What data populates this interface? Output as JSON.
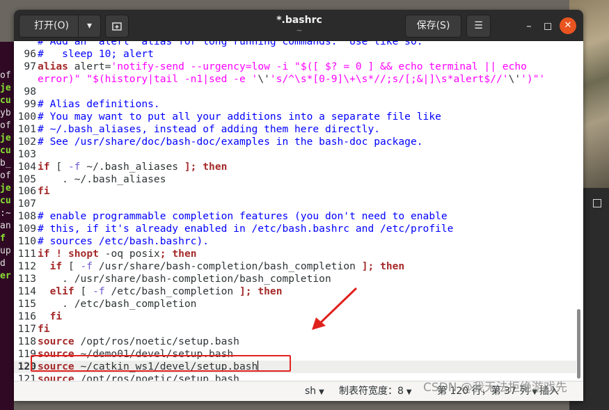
{
  "window": {
    "title": "*.bashrc",
    "subtitle": "~",
    "open_label": "打开(O)",
    "save_label": "保存(S)",
    "new_tab_icon": "new-tab-icon",
    "menu_icon": "hamburger-icon",
    "minimize_icon": "minimize-icon",
    "maximize_icon": "maximize-icon",
    "close_icon": "close-icon"
  },
  "editor": {
    "current_line": 120,
    "partial_top_text": "# Add an \"alert\" alias for long running commands.  Use like so:",
    "lines": [
      {
        "n": "96",
        "segments": [
          {
            "t": "#   sleep 10; alert",
            "c": "comment"
          }
        ]
      },
      {
        "n": "97",
        "segments": [
          {
            "t": "alias",
            "c": "kw"
          },
          {
            "t": " alert=",
            "c": "plain"
          },
          {
            "t": "'notify-send --urgency=low -i \"$([ $? = 0 ] && echo terminal || echo",
            "c": "str"
          }
        ]
      },
      {
        "n": "",
        "segments": [
          {
            "t": "error)\" \"$(history|tail -n1|sed -e '",
            "c": "str"
          },
          {
            "t": "\\'",
            "c": "plain"
          },
          {
            "t": "'s/^\\s*[0-9]\\+\\s*//;s/[;&|]\\s*alert$//'",
            "c": "str"
          },
          {
            "t": "\\'",
            "c": "plain"
          },
          {
            "t": "')\"'",
            "c": "str"
          }
        ]
      },
      {
        "n": "98",
        "segments": []
      },
      {
        "n": "99",
        "segments": [
          {
            "t": "# Alias definitions.",
            "c": "comment"
          }
        ]
      },
      {
        "n": "100",
        "segments": [
          {
            "t": "# You may want to put all your additions into a separate file like",
            "c": "comment"
          }
        ]
      },
      {
        "n": "101",
        "segments": [
          {
            "t": "# ~/.bash_aliases, instead of adding them here directly.",
            "c": "comment"
          }
        ]
      },
      {
        "n": "102",
        "segments": [
          {
            "t": "# See /usr/share/doc/bash-doc/examples in the bash-doc package.",
            "c": "comment"
          }
        ]
      },
      {
        "n": "103",
        "segments": []
      },
      {
        "n": "104",
        "segments": [
          {
            "t": "if",
            "c": "kw"
          },
          {
            "t": " [ ",
            "c": "plain"
          },
          {
            "t": "-f",
            "c": "flag"
          },
          {
            "t": " ~/.bash_aliases ",
            "c": "plain"
          },
          {
            "t": "];",
            "c": "kw"
          },
          {
            "t": " ",
            "c": "plain"
          },
          {
            "t": "then",
            "c": "kw"
          }
        ]
      },
      {
        "n": "105",
        "segments": [
          {
            "t": "    . ~/.bash_aliases",
            "c": "plain"
          }
        ]
      },
      {
        "n": "106",
        "segments": [
          {
            "t": "fi",
            "c": "kw"
          }
        ]
      },
      {
        "n": "107",
        "segments": []
      },
      {
        "n": "108",
        "segments": [
          {
            "t": "# enable programmable completion features (you don't need to enable",
            "c": "comment"
          }
        ]
      },
      {
        "n": "109",
        "segments": [
          {
            "t": "# this, if it's already enabled in /etc/bash.bashrc and /etc/profile",
            "c": "comment"
          }
        ]
      },
      {
        "n": "110",
        "segments": [
          {
            "t": "# sources /etc/bash.bashrc).",
            "c": "comment"
          }
        ]
      },
      {
        "n": "111",
        "segments": [
          {
            "t": "if",
            "c": "kw"
          },
          {
            "t": " ",
            "c": "plain"
          },
          {
            "t": "!",
            "c": "kw"
          },
          {
            "t": " ",
            "c": "plain"
          },
          {
            "t": "shopt",
            "c": "kw"
          },
          {
            "t": " -oq posix",
            "c": "plain"
          },
          {
            "t": ";",
            "c": "kw"
          },
          {
            "t": " ",
            "c": "plain"
          },
          {
            "t": "then",
            "c": "kw"
          }
        ]
      },
      {
        "n": "112",
        "segments": [
          {
            "t": "  ",
            "c": "plain"
          },
          {
            "t": "if",
            "c": "kw"
          },
          {
            "t": " [ ",
            "c": "plain"
          },
          {
            "t": "-f",
            "c": "flag"
          },
          {
            "t": " /usr/share/bash-completion/bash_completion ",
            "c": "plain"
          },
          {
            "t": "];",
            "c": "kw"
          },
          {
            "t": " ",
            "c": "plain"
          },
          {
            "t": "then",
            "c": "kw"
          }
        ]
      },
      {
        "n": "113",
        "segments": [
          {
            "t": "    . /usr/share/bash-completion/bash_completion",
            "c": "plain"
          }
        ]
      },
      {
        "n": "114",
        "segments": [
          {
            "t": "  ",
            "c": "plain"
          },
          {
            "t": "elif",
            "c": "kw"
          },
          {
            "t": " [ ",
            "c": "plain"
          },
          {
            "t": "-f",
            "c": "flag"
          },
          {
            "t": " /etc/bash_completion ",
            "c": "plain"
          },
          {
            "t": "];",
            "c": "kw"
          },
          {
            "t": " ",
            "c": "plain"
          },
          {
            "t": "then",
            "c": "kw"
          }
        ]
      },
      {
        "n": "115",
        "segments": [
          {
            "t": "    . /etc/bash_completion",
            "c": "plain"
          }
        ]
      },
      {
        "n": "116",
        "segments": [
          {
            "t": "  ",
            "c": "plain"
          },
          {
            "t": "fi",
            "c": "kw"
          }
        ]
      },
      {
        "n": "117",
        "segments": [
          {
            "t": "fi",
            "c": "kw"
          }
        ]
      },
      {
        "n": "118",
        "segments": [
          {
            "t": "source",
            "c": "kw"
          },
          {
            "t": " /opt/ros/noetic/setup.bash",
            "c": "plain"
          }
        ]
      },
      {
        "n": "119",
        "segments": [
          {
            "t": "source",
            "c": "kw"
          },
          {
            "t": " ~/demo01/devel/setup.bash",
            "c": "plain"
          }
        ]
      },
      {
        "n": "120",
        "segments": [
          {
            "t": "source",
            "c": "kw"
          },
          {
            "t": " ~/catkin_ws1/devel/setup.bash",
            "c": "plain"
          }
        ]
      },
      {
        "n": "121",
        "segments": [
          {
            "t": "source",
            "c": "kw"
          },
          {
            "t": " /opt/ros/noetic/setup.bash",
            "c": "plain"
          }
        ]
      }
    ]
  },
  "statusbar": {
    "language": "sh",
    "tab_width": "制表符宽度：8",
    "position": "第 120 行，第 37 列",
    "insert_mode": "插入"
  },
  "watermark": "CSDN @我无法拒绝游戏先",
  "terminal_fragments": [
    "of",
    "je",
    "cu",
    "yb",
    "of",
    "je",
    "cu",
    "b_",
    "of",
    "je",
    "cu",
    ":~",
    "an",
    " ",
    "f",
    "up",
    "d",
    " ",
    "er"
  ],
  "colors": {
    "accent": "#e95420",
    "highlight_box": "#e0221e",
    "comment": "#0000ff",
    "keyword": "#a52a2a",
    "string": "#ff00ff"
  }
}
